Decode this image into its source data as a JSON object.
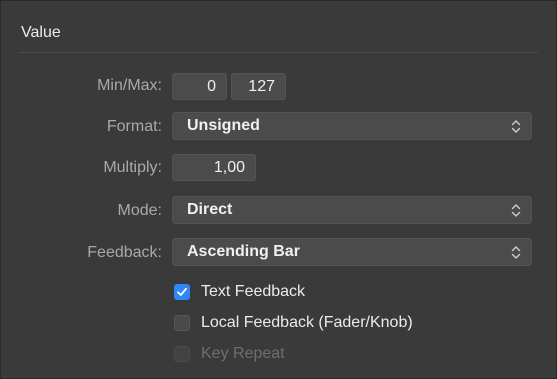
{
  "section": {
    "title": "Value"
  },
  "min_max": {
    "label": "Min/Max:",
    "min_value": "0",
    "max_value": "127"
  },
  "format": {
    "label": "Format:",
    "selected": "Unsigned"
  },
  "multiply": {
    "label": "Multiply:",
    "value": "1,00"
  },
  "mode": {
    "label": "Mode:",
    "selected": "Direct"
  },
  "feedback": {
    "label": "Feedback:",
    "selected": "Ascending Bar"
  },
  "options": {
    "text_feedback": {
      "label": "Text Feedback",
      "checked": true,
      "enabled": true
    },
    "local_feedback": {
      "label": "Local Feedback (Fader/Knob)",
      "checked": false,
      "enabled": true
    },
    "key_repeat": {
      "label": "Key Repeat",
      "checked": false,
      "enabled": false
    }
  },
  "colors": {
    "accent": "#2f86f6",
    "panel_bg": "#3a3a3a",
    "field_bg": "#4b4b4b",
    "label_text": "#a9a9a9",
    "value_text": "#f0f0f0"
  },
  "icons": {
    "select_chevrons": "chevron-up-down-icon",
    "checkmark": "checkmark-icon"
  }
}
